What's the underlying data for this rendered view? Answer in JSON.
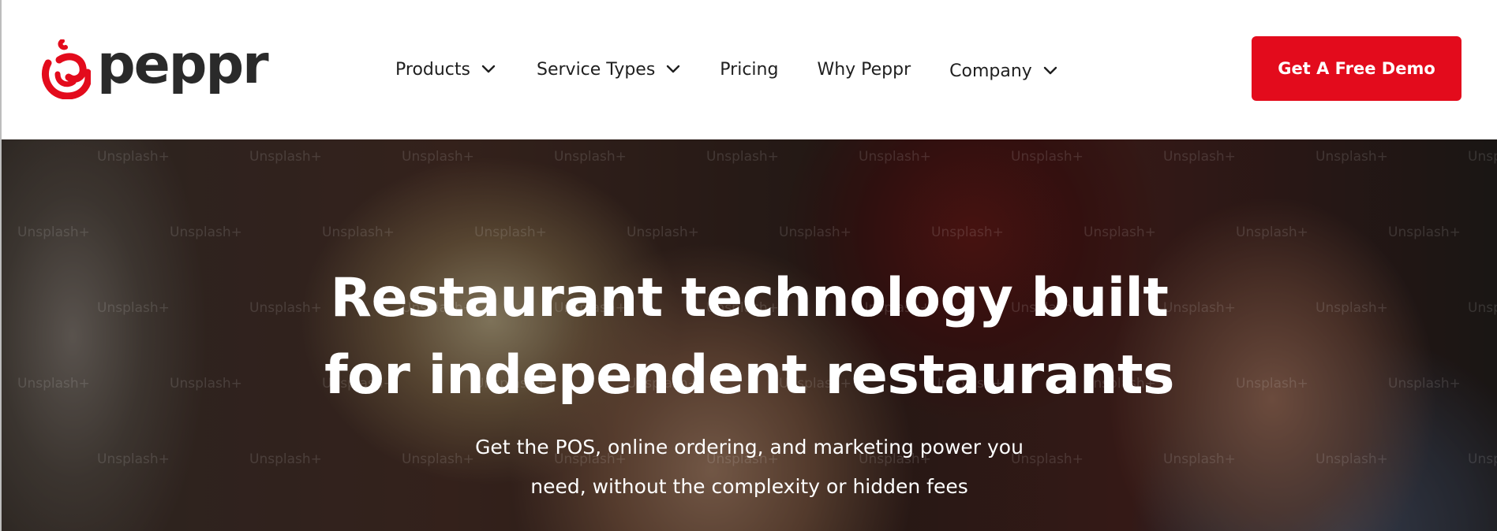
{
  "brand": {
    "name": "peppr",
    "accent_color": "#e30b1c"
  },
  "nav": {
    "items": [
      {
        "label": "Products",
        "has_dropdown": true
      },
      {
        "label": "Service Types",
        "has_dropdown": true
      },
      {
        "label": "Pricing",
        "has_dropdown": false
      },
      {
        "label": "Why Peppr",
        "has_dropdown": false
      },
      {
        "label": "Company",
        "has_dropdown": true
      }
    ]
  },
  "cta": {
    "label": "Get A Free Demo"
  },
  "hero": {
    "title_line1": "Restaurant technology built",
    "title_line2": "for independent restaurants",
    "subtitle_line1": "Get the POS, online ordering, and marketing power you",
    "subtitle_line2": "need, without the complexity or hidden fees",
    "watermark_text": "Unsplash+"
  },
  "icons": {
    "logo": "pepper-logo-icon",
    "dropdown": "chevron-down-icon"
  }
}
